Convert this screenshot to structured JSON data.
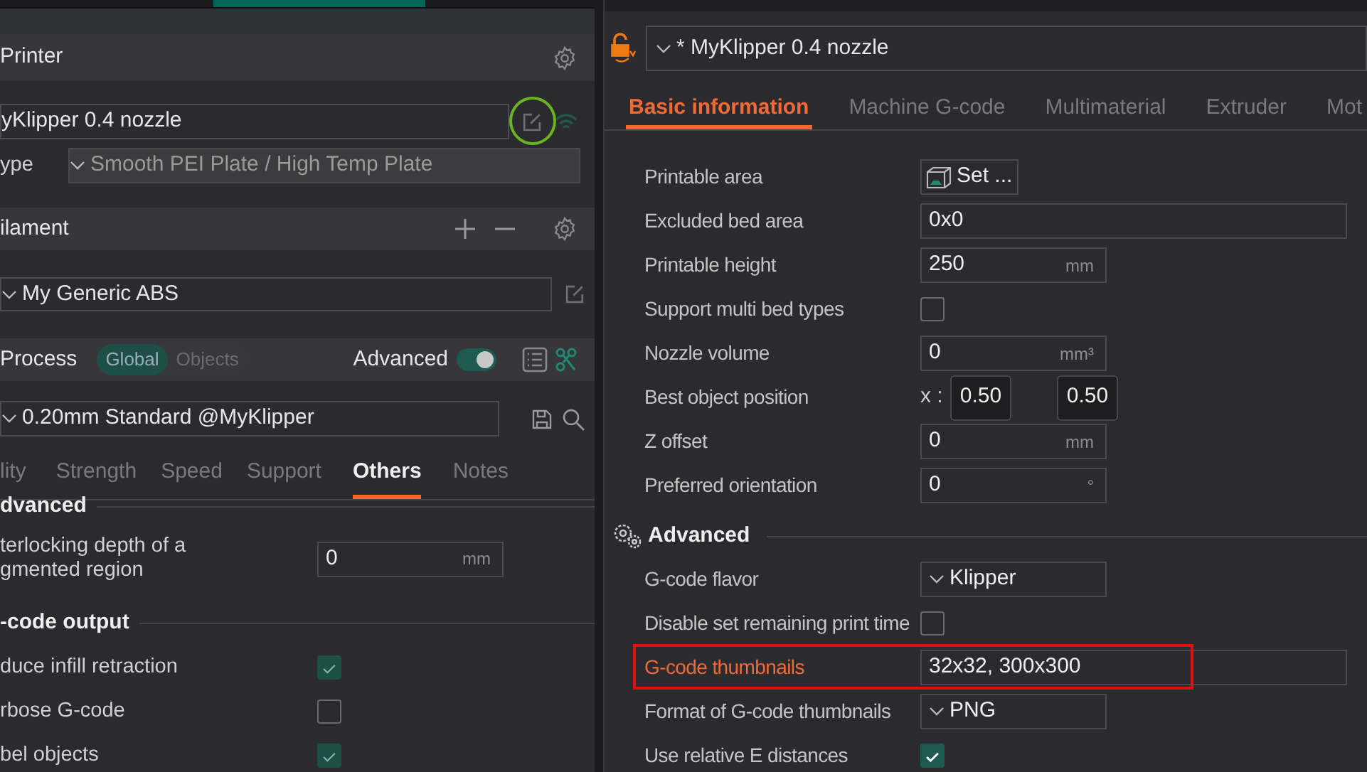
{
  "left_panel": {
    "printer": {
      "title": "Printer",
      "preset": "yKlipper 0.4 nozzle",
      "edit_circled": true,
      "bed_type_label": "ype",
      "bed_type": "Smooth PEI Plate / High Temp Plate"
    },
    "filament": {
      "title": "ilament",
      "preset": "My Generic ABS"
    },
    "process": {
      "title": "Process",
      "scope": [
        {
          "label": "Global",
          "selected": true
        },
        {
          "label": "Objects",
          "selected": false
        }
      ],
      "advanced_label": "Advanced",
      "advanced_on": true,
      "preset": "0.20mm Standard @MyKlipper"
    },
    "tabs": [
      {
        "label": "lity",
        "selected": false
      },
      {
        "label": "Strength",
        "selected": false
      },
      {
        "label": "Speed",
        "selected": false
      },
      {
        "label": "Support",
        "selected": false
      },
      {
        "label": "Others",
        "selected": true
      },
      {
        "label": "Notes",
        "selected": false
      }
    ],
    "groups": [
      {
        "title": "dvanced",
        "rows": [
          {
            "kind": "field",
            "label": "terlocking depth of a\ngmented region",
            "value": "0",
            "unit": "mm"
          }
        ]
      },
      {
        "title": "-code output",
        "rows": [
          {
            "kind": "checkbox",
            "label": "duce infill retraction",
            "checked": true
          },
          {
            "kind": "checkbox",
            "label": "rbose G-code",
            "checked": false
          },
          {
            "kind": "checkbox",
            "label": "bel objects",
            "checked": true
          }
        ]
      }
    ]
  },
  "right_panel": {
    "preset": "* MyKlipper 0.4 nozzle",
    "tabs": [
      {
        "label": "Basic information",
        "selected": true
      },
      {
        "label": "Machine G-code",
        "selected": false
      },
      {
        "label": "Multimaterial",
        "selected": false
      },
      {
        "label": "Extruder",
        "selected": false
      },
      {
        "label": "Mot",
        "selected": false
      }
    ],
    "groups": [
      {
        "rows": [
          {
            "kind": "button",
            "label": "Printable area",
            "value": "Set ...",
            "highlighted": false
          },
          {
            "kind": "wide_field",
            "label": "Excluded bed area",
            "value": "0x0",
            "highlighted": false
          },
          {
            "kind": "field",
            "label": "Printable height",
            "value": "250",
            "unit": "mm",
            "highlighted": false
          },
          {
            "kind": "checkbox",
            "label": "Support multi bed types",
            "checked": false,
            "highlighted": false
          },
          {
            "kind": "field",
            "label": "Nozzle volume",
            "value": "0",
            "unit": "mm³",
            "highlighted": false
          },
          {
            "kind": "xy",
            "label": "Best object position",
            "prefix": "x :",
            "values": [
              "0.50",
              "0.50"
            ],
            "highlighted": false
          },
          {
            "kind": "field",
            "label": "Z offset",
            "value": "0",
            "unit": "mm",
            "highlighted": false
          },
          {
            "kind": "field",
            "label": "Preferred orientation",
            "value": "0",
            "unit": "°",
            "highlighted": false
          }
        ]
      },
      {
        "title": "Advanced",
        "rows": [
          {
            "kind": "dropdown",
            "label": "G-code flavor",
            "value": "Klipper",
            "highlighted": false
          },
          {
            "kind": "checkbox",
            "label": "Disable set remaining print time",
            "checked": false,
            "highlighted": false
          },
          {
            "kind": "wide_field",
            "label": "G-code thumbnails",
            "value": "32x32, 300x300",
            "highlighted": true
          },
          {
            "kind": "dropdown",
            "label": "Format of G-code thumbnails",
            "value": "PNG",
            "highlighted": false
          },
          {
            "kind": "checkbox",
            "label": "Use relative E distances",
            "checked": true,
            "highlighted": false
          }
        ]
      }
    ]
  }
}
